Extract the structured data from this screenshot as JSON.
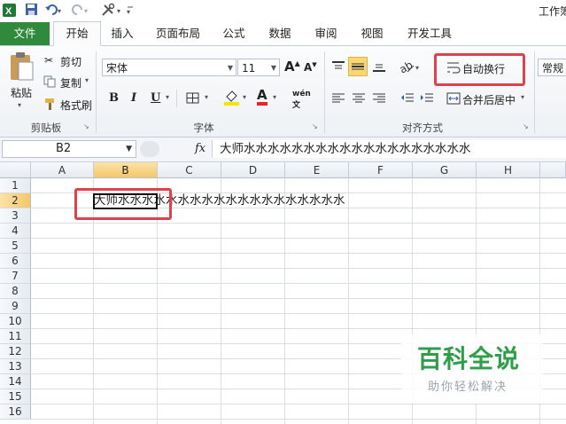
{
  "window": {
    "title": "工作簿"
  },
  "tabs": [
    "文件",
    "开始",
    "插入",
    "页面布局",
    "公式",
    "数据",
    "审阅",
    "视图",
    "开发工具"
  ],
  "ribbon": {
    "clipboard": {
      "paste": "粘贴",
      "cut": "剪切",
      "copy": "复制",
      "format_painter": "格式刷",
      "label": "剪贴板"
    },
    "font": {
      "name": "宋体",
      "size": "11",
      "label": "字体",
      "bold": "B",
      "italic": "I",
      "underline": "U",
      "grow": "A",
      "shrink": "A",
      "font_color": "A",
      "phonetic": "wén"
    },
    "alignment": {
      "wrap_text": "自动换行",
      "merge_center": "合并后居中",
      "label": "对齐方式"
    },
    "number": {
      "format": "常规"
    }
  },
  "formula_bar": {
    "name_box": "B2",
    "fx": "fx",
    "content": "大师水水水水水水水水水水水水水水水水水水水"
  },
  "sheet": {
    "columns": [
      "A",
      "B",
      "C",
      "D",
      "E",
      "F",
      "G",
      "H"
    ],
    "rows": [
      "1",
      "2",
      "3",
      "4",
      "5",
      "6",
      "7",
      "8",
      "9",
      "10",
      "11",
      "12",
      "13",
      "14",
      "15",
      "16"
    ],
    "selected_col": "B",
    "selected_row": "2",
    "cell_b2": "大师水水水水水水水水水水水水水水水水水水水"
  },
  "watermark": {
    "title": "百科全说",
    "subtitle": "助你轻松解决"
  },
  "colors": {
    "file_tab": "#2f8a3c",
    "highlight": "#e0414c",
    "selected_header": "#f4c76a"
  }
}
